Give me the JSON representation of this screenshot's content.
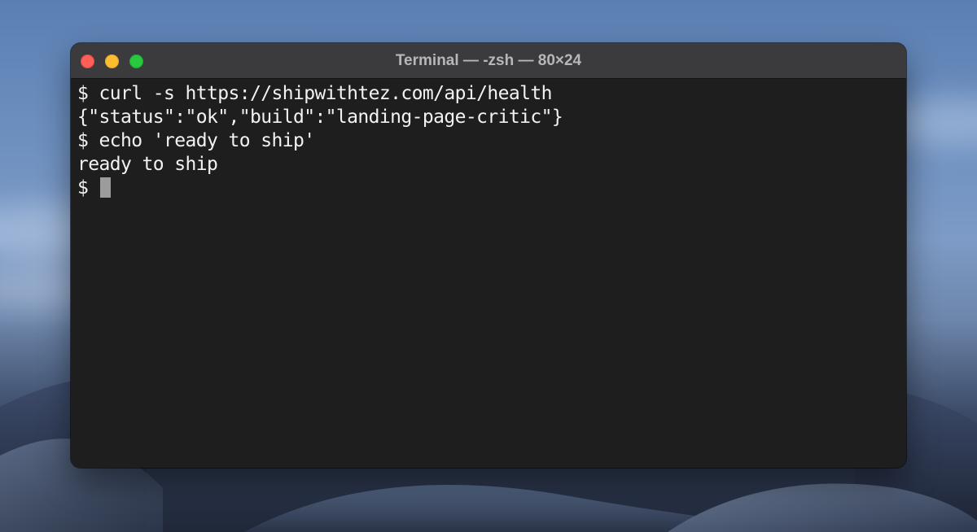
{
  "window": {
    "title": "Terminal — -zsh — 80×24",
    "traffic_lights": {
      "close": "#fe5f57",
      "minimize": "#febc2e",
      "zoom": "#28c840"
    }
  },
  "terminal": {
    "prompt": "$ ",
    "lines": [
      "$ curl -s https://shipwithtez.com/api/health",
      "{\"status\":\"ok\",\"build\":\"landing-page-critic\"}",
      "$ echo 'ready to ship'",
      "ready to ship"
    ],
    "background": "#1e1e1e",
    "foreground": "#f2f2f2"
  }
}
